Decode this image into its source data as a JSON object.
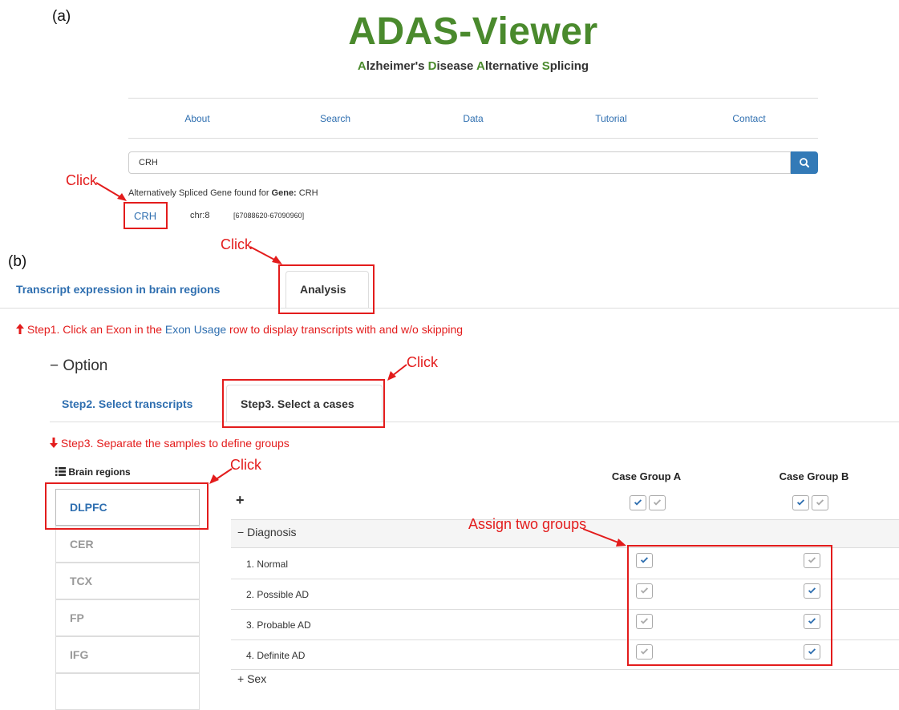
{
  "panel_labels": {
    "a": "(a)",
    "b": "(b)"
  },
  "header": {
    "title": "ADAS-Viewer",
    "subtitle_parts": [
      {
        "text": "A",
        "hl": true
      },
      {
        "text": "lzheimer's ",
        "hl": false
      },
      {
        "text": "D",
        "hl": true
      },
      {
        "text": "isease ",
        "hl": false
      },
      {
        "text": "A",
        "hl": true
      },
      {
        "text": "lternative ",
        "hl": false
      },
      {
        "text": "S",
        "hl": true
      },
      {
        "text": "plicing",
        "hl": false
      }
    ]
  },
  "nav": [
    "About",
    "Search",
    "Data",
    "Tutorial",
    "Contact"
  ],
  "search": {
    "value": "CRH",
    "icon": "search-icon"
  },
  "result": {
    "prefix": "Alternatively Spliced Gene found for ",
    "bold": "Gene:",
    "suffix": " CRH",
    "gene": "CRH",
    "chr": "chr:8",
    "range": "[67088620-67090960]"
  },
  "annotations": {
    "click": "Click",
    "assign": "Assign two groups"
  },
  "main_tabs": {
    "tab1": "Transcript expression in brain regions",
    "tab2": "Analysis"
  },
  "step1": {
    "pre": "Step1. Click an Exon in the ",
    "link": "Exon Usage",
    "post": " row to display transcripts with and w/o skipping"
  },
  "option": "Option",
  "sub_tabs": {
    "tab1": "Step2. Select transcripts",
    "tab2": "Step3. Select a cases"
  },
  "step3": "Step3. Separate the samples to define groups",
  "brain_regions": {
    "heading": "Brain regions",
    "items": [
      "DLPFC",
      "CER",
      "TCX",
      "FP",
      "IFG"
    ]
  },
  "groups": {
    "a": "Case Group A",
    "b": "Case Group B"
  },
  "diagnosis": {
    "label": "Diagnosis",
    "rows": [
      {
        "label": "1. Normal",
        "a": true,
        "b": false
      },
      {
        "label": "2. Possible AD",
        "a": false,
        "b": true
      },
      {
        "label": "3. Probable AD",
        "a": false,
        "b": true
      },
      {
        "label": "4. Definite AD",
        "a": false,
        "b": true
      }
    ]
  },
  "sex_label": "Sex",
  "colors": {
    "accent": "#2f6fb0",
    "brand": "#4a8a2d",
    "annotation": "#e31c1c"
  }
}
